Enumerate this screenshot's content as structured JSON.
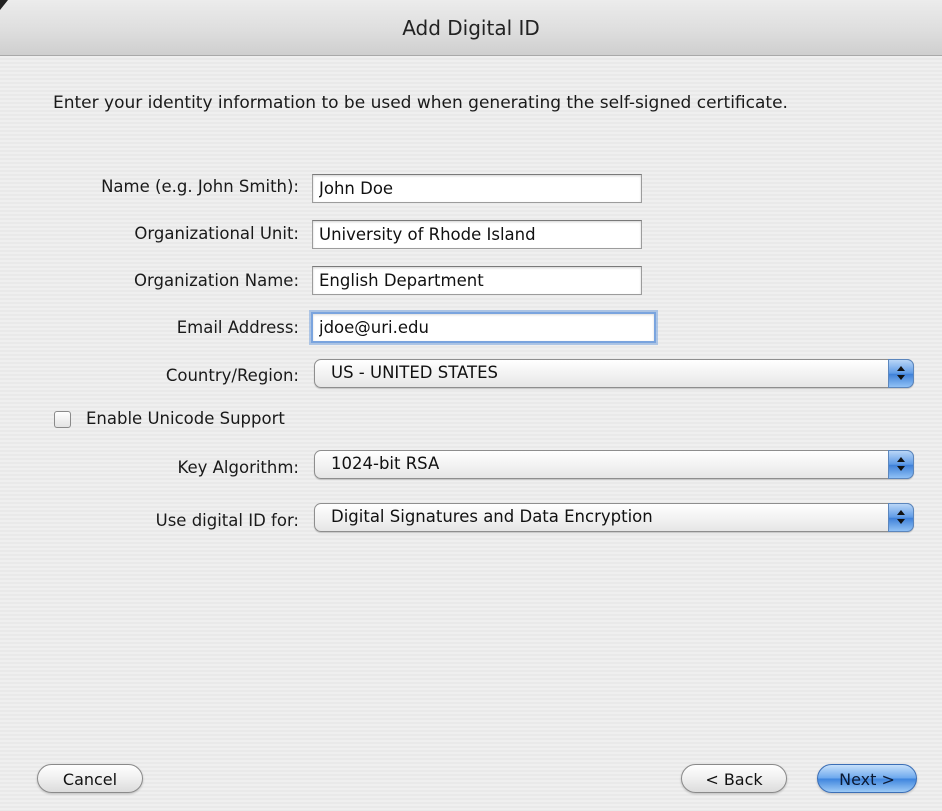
{
  "window": {
    "title": "Add Digital ID"
  },
  "intro": "Enter your identity information to be used when generating the self-signed certificate.",
  "form": {
    "name": {
      "label": "Name (e.g. John Smith):",
      "value": "John Doe"
    },
    "org_unit": {
      "label": "Organizational Unit:",
      "value": "University of Rhode Island"
    },
    "org_name": {
      "label": "Organization Name:",
      "value": "English Department"
    },
    "email": {
      "label": "Email Address:",
      "value": "jdoe@uri.edu"
    },
    "country": {
      "label": "Country/Region:",
      "value": "US - UNITED STATES"
    },
    "unicode": {
      "label": "Enable Unicode Support",
      "checked": false
    },
    "key_algorithm": {
      "label": "Key Algorithm:",
      "value": "1024-bit RSA"
    },
    "use_for": {
      "label": "Use digital ID for:",
      "value": "Digital Signatures and Data Encryption"
    }
  },
  "buttons": {
    "cancel": "Cancel",
    "back": "< Back",
    "next": "Next >"
  }
}
